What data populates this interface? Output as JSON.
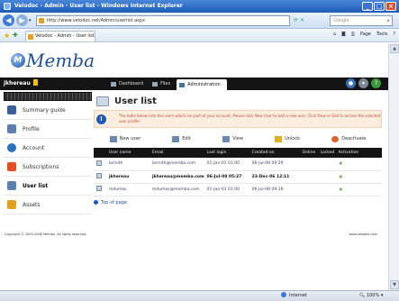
{
  "window": {
    "title": "Velodoc - Admin - User list - Windows Internet Explorer"
  },
  "browser": {
    "url": "http://www.velodoc.net/Admin/userlist.aspx",
    "search_placeholder": "Google",
    "tab_label": "Velodoc - Admin - User list",
    "commands": [
      "Page",
      "Tools"
    ]
  },
  "app": {
    "logo_text": "Memba",
    "user": "jkhereau",
    "nav": [
      {
        "label": "Dashboard"
      },
      {
        "label": "Files"
      },
      {
        "label": "Administration"
      }
    ]
  },
  "sidebar": {
    "items": [
      {
        "label": "Summary guide",
        "color": "#3a5f9a"
      },
      {
        "label": "Profile",
        "color": "#5b7fb0"
      },
      {
        "label": "Account",
        "color": "#2a6fc0"
      },
      {
        "label": "Subscriptions",
        "color": "#e05020"
      },
      {
        "label": "User list",
        "color": "#5b7fb0"
      },
      {
        "label": "Assets",
        "color": "#e0a020"
      }
    ]
  },
  "main": {
    "title": "User list",
    "info": "The table below lists the users which are part of your account. Please click New User to add a new user. Click View or Edit to access the selected user profile.",
    "toolbar": [
      "New user",
      "Edit",
      "View",
      "Unlock",
      "Deactivate"
    ],
    "table": {
      "headers": [
        "User name",
        "Email",
        "Last login",
        "Created on",
        "Online",
        "Locked",
        "Activation"
      ],
      "rows": [
        {
          "user": "bsmith",
          "email": "bsmith@memba.com",
          "last": "01-Jan-01 01:00",
          "created": "06-Jul-08 09:29",
          "bold": false
        },
        {
          "user": "jkhereau",
          "email": "jkhereau@memba.com",
          "last": "06-Jul-08 05:27",
          "created": "23-Dec-06 12:11",
          "bold": true
        },
        {
          "user": "mdumas",
          "email": "mdumas@memba.com",
          "last": "01-Jan-01 01:00",
          "created": "06-Jul-08 09:28",
          "bold": false
        }
      ]
    },
    "top_link": "Top of page"
  },
  "footer": {
    "copyright": "Copyright © 2005-2008 Memba. All rights reserved.",
    "site": "www.velodoc.com"
  },
  "status": {
    "zone": "Internet",
    "zoom": "100%"
  }
}
